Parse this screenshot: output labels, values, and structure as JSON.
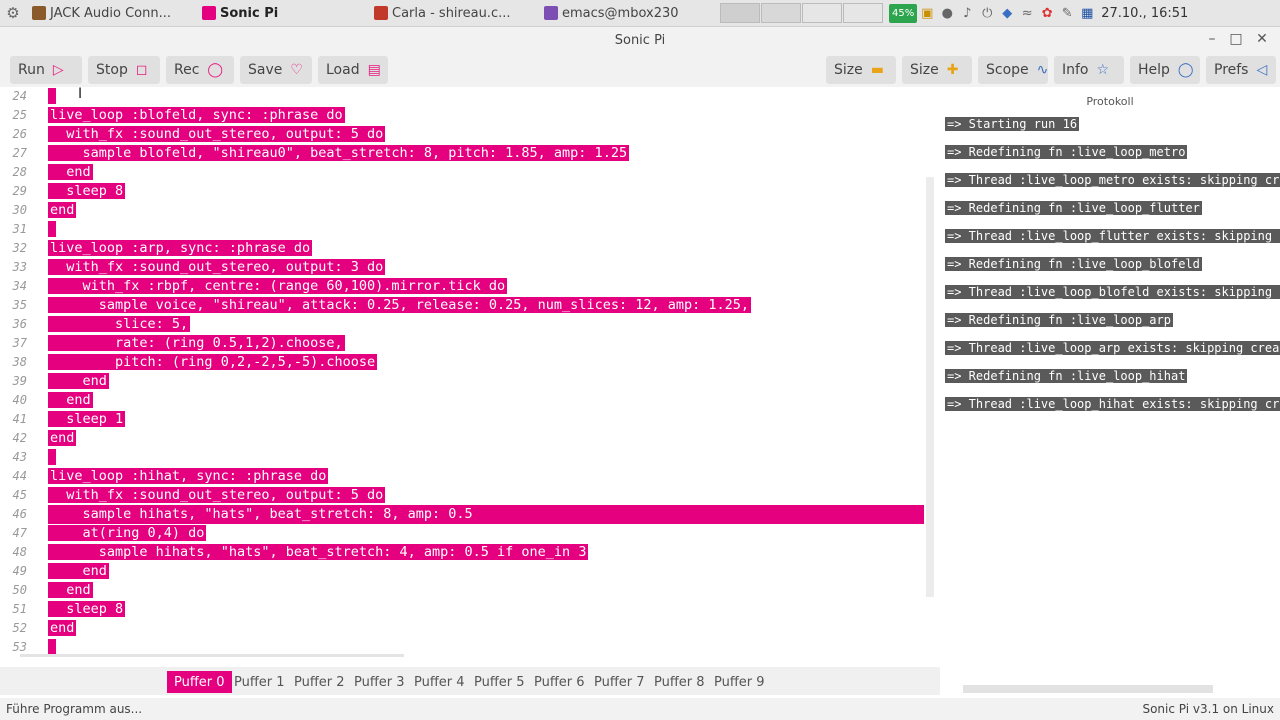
{
  "taskbar": {
    "tasks": [
      {
        "label": "JACK Audio Conn...",
        "icon": "jack-icon",
        "color": "#8b5a2b",
        "active": false
      },
      {
        "label": "Sonic Pi",
        "icon": "sonic-pi-icon",
        "color": "#e4007f",
        "active": true
      },
      {
        "label": "Carla - shireau.c...",
        "icon": "carla-icon",
        "color": "#c0392b",
        "active": false
      },
      {
        "label": "emacs@mbox230",
        "icon": "emacs-icon",
        "color": "#7d4fb3",
        "active": false
      }
    ],
    "battery": "45%",
    "clock": "27.10., 16:51"
  },
  "window": {
    "title": "Sonic Pi"
  },
  "toolbar": {
    "run": "Run",
    "stop": "Stop",
    "rec": "Rec",
    "save": "Save",
    "load": "Load",
    "size_minus": "Size",
    "size_plus": "Size",
    "scope": "Scope",
    "info": "Info",
    "help": "Help",
    "prefs": "Prefs"
  },
  "editor": {
    "lines": [
      {
        "n": "24",
        "indent": "",
        "text": ""
      },
      {
        "n": "25",
        "indent": "",
        "text": "live_loop :blofeld, sync: :phrase do"
      },
      {
        "n": "26",
        "indent": "  ",
        "text": "with_fx :sound_out_stereo, output: 5 do"
      },
      {
        "n": "27",
        "indent": "    ",
        "text": "sample blofeld, \"shireau0\", beat_stretch: 8, pitch: 1.85, amp: 1.25"
      },
      {
        "n": "28",
        "indent": "  ",
        "text": "end"
      },
      {
        "n": "29",
        "indent": "  ",
        "text": "sleep 8"
      },
      {
        "n": "30",
        "indent": "",
        "text": "end"
      },
      {
        "n": "31",
        "indent": "",
        "text": ""
      },
      {
        "n": "32",
        "indent": "",
        "text": "live_loop :arp, sync: :phrase do"
      },
      {
        "n": "33",
        "indent": "  ",
        "text": "with_fx :sound_out_stereo, output: 3 do"
      },
      {
        "n": "34",
        "indent": "    ",
        "text": "with_fx :rbpf, centre: (range 60,100).mirror.tick do"
      },
      {
        "n": "35",
        "indent": "      ",
        "text": "sample voice, \"shireau\", attack: 0.25, release: 0.25, num_slices: 12, amp: 1.25,"
      },
      {
        "n": "36",
        "indent": "        ",
        "text": "slice: 5,"
      },
      {
        "n": "37",
        "indent": "        ",
        "text": "rate: (ring 0.5,1,2).choose,"
      },
      {
        "n": "38",
        "indent": "        ",
        "text": "pitch: (ring 0,2,-2,5,-5).choose"
      },
      {
        "n": "39",
        "indent": "    ",
        "text": "end"
      },
      {
        "n": "40",
        "indent": "  ",
        "text": "end"
      },
      {
        "n": "41",
        "indent": "  ",
        "text": "sleep 1"
      },
      {
        "n": "42",
        "indent": "",
        "text": "end"
      },
      {
        "n": "43",
        "indent": "",
        "text": ""
      },
      {
        "n": "44",
        "indent": "",
        "text": "live_loop :hihat, sync: :phrase do"
      },
      {
        "n": "45",
        "indent": "  ",
        "text": "with_fx :sound_out_stereo, output: 5 do"
      },
      {
        "n": "46",
        "indent": "    ",
        "text": "sample hihats, \"hats\", beat_stretch: 8, amp: 0.5",
        "full": true
      },
      {
        "n": "47",
        "indent": "    ",
        "text": "at(ring 0,4) do"
      },
      {
        "n": "48",
        "indent": "      ",
        "text": "sample hihats, \"hats\", beat_stretch: 4, amp: 0.5 if one_in 3"
      },
      {
        "n": "49",
        "indent": "    ",
        "text": "end"
      },
      {
        "n": "50",
        "indent": "  ",
        "text": "end"
      },
      {
        "n": "51",
        "indent": "  ",
        "text": "sleep 8"
      },
      {
        "n": "52",
        "indent": "",
        "text": "end"
      },
      {
        "n": "53",
        "indent": "",
        "text": ""
      }
    ]
  },
  "log": {
    "title": "Protokoll",
    "lines": [
      "=> Starting run 16",
      "=> Redefining fn :live_loop_metro",
      "=> Thread :live_loop_metro exists: skipping creation",
      "=> Redefining fn :live_loop_flutter",
      "=> Thread :live_loop_flutter exists: skipping creation",
      "=> Redefining fn :live_loop_blofeld",
      "=> Thread :live_loop_blofeld exists: skipping creation",
      "=> Redefining fn :live_loop_arp",
      "=> Thread :live_loop_arp exists: skipping creation",
      "=> Redefining fn :live_loop_hihat",
      "=> Thread :live_loop_hihat exists: skipping creation"
    ]
  },
  "tabs": [
    "Puffer 0",
    "Puffer 1",
    "Puffer 2",
    "Puffer 3",
    "Puffer 4",
    "Puffer 5",
    "Puffer 6",
    "Puffer 7",
    "Puffer 8",
    "Puffer 9"
  ],
  "status": {
    "left": "Führe Programm aus...",
    "right": "Sonic Pi v3.1 on Linux"
  },
  "colors": {
    "accent": "#e4007f",
    "log_bg": "#5a5a5a"
  }
}
